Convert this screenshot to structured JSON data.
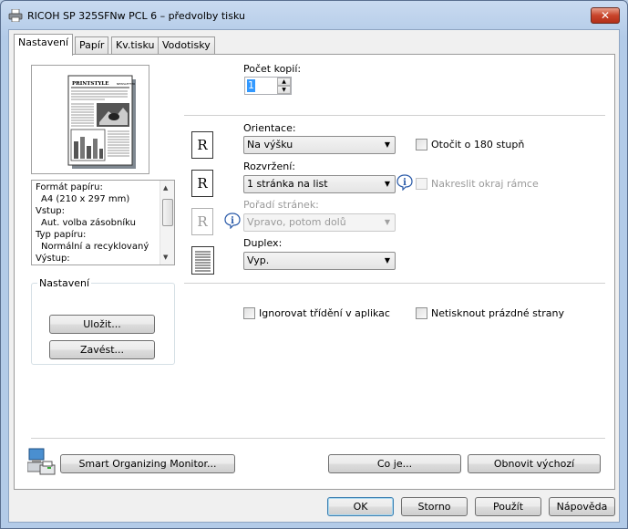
{
  "window": {
    "title": "RICOH SP 325SFNw PCL 6 – předvolby tisku",
    "close_glyph": "✕"
  },
  "tabs": [
    {
      "label": "Nastavení",
      "active": true
    },
    {
      "label": "Papír",
      "active": false
    },
    {
      "label": "Kv.tisku",
      "active": false
    },
    {
      "label": "Vodotisky",
      "active": false
    }
  ],
  "copies": {
    "label": "Počet kopií:",
    "value": "1"
  },
  "info_list": [
    "Formát papíru:",
    "A4 (210 x 297 mm)",
    "Vstup:",
    "Aut. volba zásobníku",
    "Typ papíru:",
    "Normální a recyklovaný",
    "Výstup:"
  ],
  "preset_group": {
    "label": "Nastavení",
    "save_label": "Uložit...",
    "load_label": "Zavést..."
  },
  "orientation": {
    "label": "Orientace:",
    "value": "Na výšku",
    "rotate_label": "Otočit o 180 stupň"
  },
  "layout": {
    "label": "Rozvržení:",
    "value": "1 stránka na list",
    "border_label": "Nakreslit okraj rámce"
  },
  "page_order": {
    "label": "Pořadí stránek:",
    "value": "Vpravo, potom dolů"
  },
  "duplex": {
    "label": "Duplex:",
    "value": "Vyp."
  },
  "options": {
    "ignore_collate_label": "Ignorovat třídění v aplikac",
    "skip_blank_label": "Netisknout prázdné strany"
  },
  "page_icon_letter": "R",
  "bottom_panel": {
    "monitor_label": "Smart Organizing Monitor...",
    "about_label": "Co je...",
    "restore_label": "Obnovit výchozí"
  },
  "dialog_buttons": {
    "ok": "OK",
    "cancel": "Storno",
    "apply": "Použít",
    "help": "Nápověda"
  },
  "preview_doc": {
    "headline": "PRINTSTYLE",
    "masthead_right": "NEWSLETTER"
  },
  "icons": {
    "printer": "printer-icon",
    "info": "info-icon",
    "computer": "computer-printer-icon"
  },
  "colors": {
    "titlebar": "#c9daf0",
    "close": "#c8432a",
    "selection": "#3399ff",
    "default_button": "#3c7fb1"
  }
}
